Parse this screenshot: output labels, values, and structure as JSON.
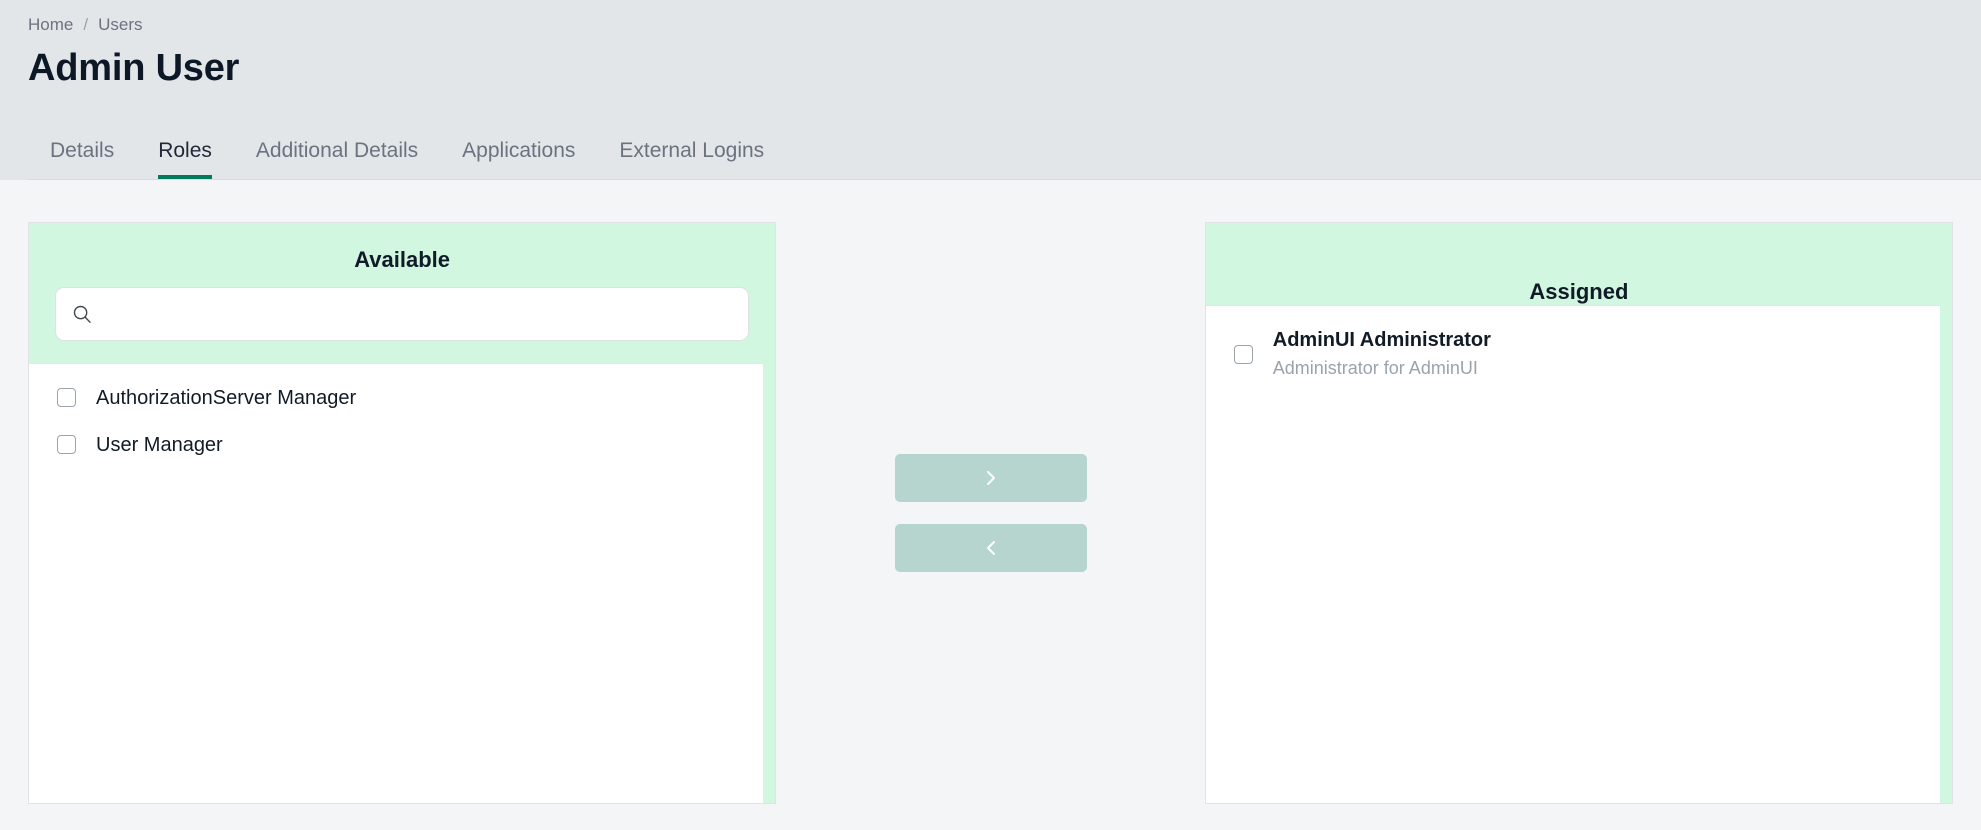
{
  "breadcrumb": {
    "items": [
      {
        "label": "Home"
      },
      {
        "label": "Users"
      }
    ],
    "separator": "/"
  },
  "page": {
    "title": "Admin User"
  },
  "tabs": [
    {
      "label": "Details",
      "active": false
    },
    {
      "label": "Roles",
      "active": true
    },
    {
      "label": "Additional Details",
      "active": false
    },
    {
      "label": "Applications",
      "active": false
    },
    {
      "label": "External Logins",
      "active": false
    }
  ],
  "available_panel": {
    "header": "Available",
    "search": {
      "value": "",
      "placeholder": "",
      "icon": "search-icon"
    },
    "items": [
      {
        "title": "AuthorizationServer Manager",
        "description": "",
        "checked": false
      },
      {
        "title": "User Manager",
        "description": "",
        "checked": false
      }
    ]
  },
  "transfer": {
    "to_assigned": {
      "icon": "chevron-right-icon",
      "label": "",
      "disabled": true
    },
    "to_available": {
      "icon": "chevron-left-icon",
      "label": "",
      "disabled": true
    }
  },
  "assigned_panel": {
    "header": "Assigned",
    "items": [
      {
        "title": "AdminUI Administrator",
        "description": "Administrator for AdminUI",
        "checked": false
      }
    ]
  },
  "colors": {
    "header_background": "#e3e6e9",
    "page_background": "#f4f5f7",
    "panel_green": "#d2f7e0",
    "accent_green": "#00795c",
    "transfer_button": "#b6d5ce",
    "title_text": "#0d1826",
    "muted_text": "#6b7280",
    "description_text": "#9aa3ad"
  }
}
